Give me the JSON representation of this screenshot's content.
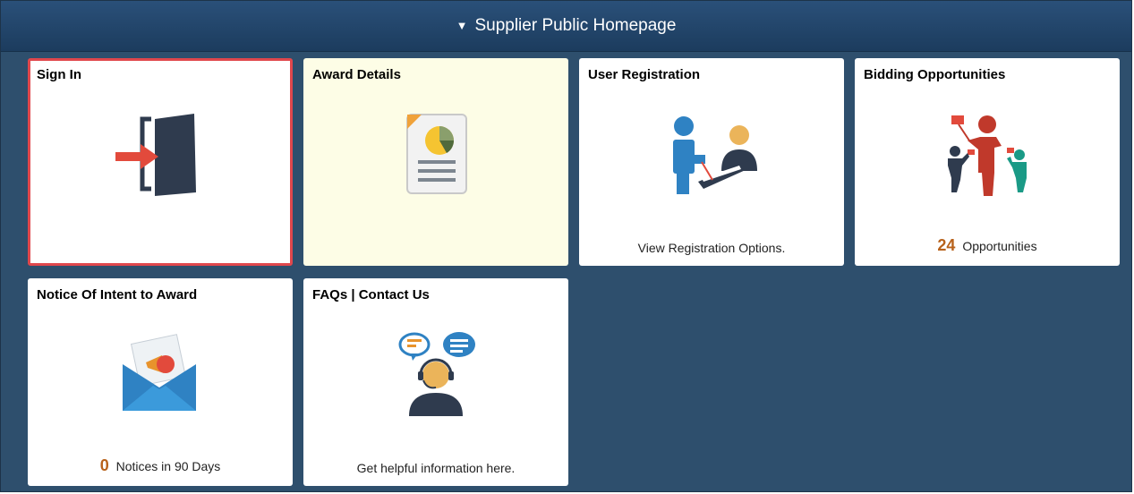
{
  "banner": {
    "title": "Supplier Public Homepage",
    "toggle_icon": "triangle-down-icon"
  },
  "tiles": {
    "sign_in": {
      "title": "Sign In",
      "icon": "sign-in-door-icon"
    },
    "award_details": {
      "title": "Award Details",
      "icon": "document-pie-chart-icon"
    },
    "user_registration": {
      "title": "User Registration",
      "icon": "user-registration-icon",
      "footer": "View Registration Options."
    },
    "bidding_opportunities": {
      "title": "Bidding Opportunities",
      "icon": "bidding-people-icon",
      "count": "24",
      "footer": "Opportunities"
    },
    "notice_of_intent": {
      "title": "Notice Of Intent to Award",
      "icon": "envelope-megaphone-icon",
      "count": "0",
      "footer": "Notices in 90 Days"
    },
    "faqs_contact": {
      "title": "FAQs | Contact Us",
      "icon": "support-agent-chat-icon",
      "footer": "Get helpful information here."
    }
  },
  "colors": {
    "background": "#2e4f6d",
    "banner": "#1f4266",
    "selected_border": "#e0474c",
    "count_text": "#b8621b",
    "award_tile": "#fdfde6"
  }
}
